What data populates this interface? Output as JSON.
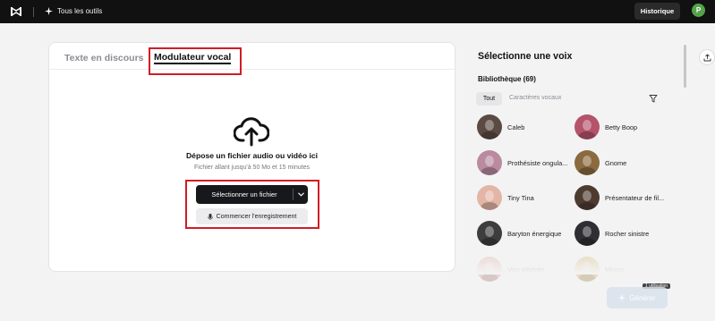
{
  "topbar": {
    "tools_label": "Tous les outils",
    "history_label": "Historique",
    "user_initial": "P"
  },
  "tabs": {
    "speech": "Texte en discours",
    "voice_modulator": "Modulateur vocal"
  },
  "upload": {
    "title": "Dépose un fichier audio ou vidéo ici",
    "subtitle": "Fichier allant jusqu'à 50 Mo et 15 minutes",
    "select_label": "Sélectionner un fichier",
    "record_label": "Commencer l'enregistrement"
  },
  "voices_panel": {
    "title": "Sélectionne une voix",
    "library_label": "Bibliothèque (69)",
    "filter_all": "Tout",
    "filter_traits": "Caractères vocaux",
    "voices": [
      {
        "name": "Caleb",
        "color": "#5a4a42"
      },
      {
        "name": "Betty Boop",
        "color": "#b5536a"
      },
      {
        "name": "Prothésiste ongula...",
        "color": "#b98aa0"
      },
      {
        "name": "Gnome",
        "color": "#8a6a3e"
      },
      {
        "name": "Tiny Tina",
        "color": "#e3b5a6"
      },
      {
        "name": "Présentateur de fil...",
        "color": "#4e3b30"
      },
      {
        "name": "Baryton énergique",
        "color": "#3d3d3d"
      },
      {
        "name": "Rocher sinistre",
        "color": "#2f2f33"
      },
      {
        "name": "Voix éthérée",
        "color": "#e1a496"
      },
      {
        "name": "Minion",
        "color": "#d4b260"
      }
    ]
  },
  "generate": {
    "label": "Générer",
    "badge": "1 utilisation"
  },
  "colors": {
    "highlight": "#d11d24",
    "topbar": "#111111",
    "primary_button": "#17181c"
  }
}
